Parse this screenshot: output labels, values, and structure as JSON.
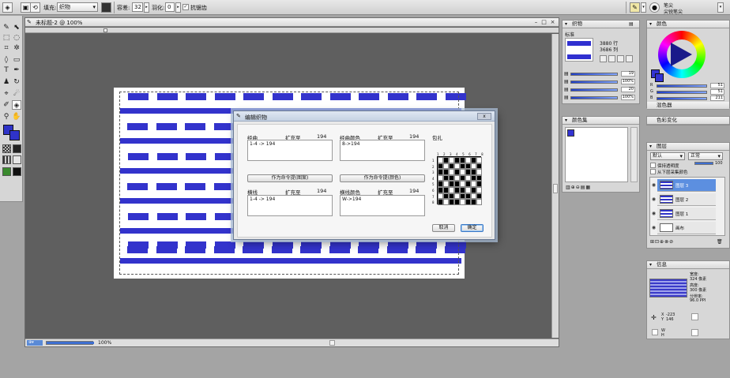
{
  "options_bar": {
    "fill_label": "填充:",
    "fill_value": "织物",
    "tolerance_label": "容差:",
    "tolerance_value": "32",
    "feather_label": "羽化:",
    "feather_value": "0",
    "antialias_label": "抗锯齿",
    "antialias_checked": true,
    "brush_line1": "笔尖",
    "brush_line2": "尖锐笔尖"
  },
  "document": {
    "title": "未标题-2 @ 100%",
    "zoom": "100%"
  },
  "canvas": {
    "bar_color": "#3333cc",
    "pattern": "woven"
  },
  "dialog": {
    "title": "编辑织物",
    "close": "x",
    "warp_label": "经曲",
    "warp_expand_label": "扩充至",
    "warp_expand_value": "194",
    "warp_text": "1-4 -> 194",
    "warp_color_label": "经曲颜色",
    "warp_color_expand_label": "扩充至",
    "warp_color_expand_value": "194",
    "warp_color_text": "8->194",
    "warp_cmd_button": "作为命令提(图案)",
    "weft_cmd_button": "作为命令提(颜色)",
    "weft_label": "横线",
    "weft_expand_label": "扩充至",
    "weft_expand_value": "194",
    "weft_text": "1-4 -> 194",
    "weft_color_label": "横线颜色",
    "weft_color_expand_label": "扩充至",
    "weft_color_expand_value": "194",
    "weft_color_text": "W->194",
    "peg_label": "包扎",
    "peg_col_numbers": "1 2 3 4 5 6 7 8",
    "peg_row_numbers": [
      "1",
      "2",
      "3",
      "4",
      "5",
      "6",
      "7",
      "8"
    ],
    "peg_grid": [
      [
        0,
        1,
        0,
        1,
        1,
        0,
        1,
        0
      ],
      [
        1,
        0,
        1,
        0,
        1,
        1,
        0,
        1
      ],
      [
        1,
        1,
        0,
        1,
        0,
        1,
        1,
        0
      ],
      [
        0,
        1,
        1,
        0,
        1,
        0,
        1,
        1
      ],
      [
        1,
        0,
        1,
        1,
        0,
        1,
        0,
        1
      ],
      [
        1,
        1,
        0,
        1,
        1,
        0,
        1,
        0
      ],
      [
        0,
        1,
        1,
        0,
        1,
        1,
        0,
        1
      ],
      [
        1,
        0,
        1,
        1,
        0,
        1,
        1,
        0
      ]
    ],
    "cancel": "取消",
    "ok": "确定"
  },
  "fabric_panel": {
    "tab": "织物",
    "preset": "标准",
    "rows": "3880 行",
    "cols": "3686 列",
    "values": [
      "19",
      "100%",
      "20",
      "100%"
    ]
  },
  "color_panel": {
    "tab": "颜色",
    "labels": [
      "R",
      "G",
      "B"
    ],
    "values": [
      "51",
      "51",
      "211"
    ],
    "sub_tab": "混色器"
  },
  "swatches_panel": {
    "tab": "颜色集",
    "variant_tab": "色彩变化"
  },
  "layers_panel": {
    "tab": "图层",
    "mode": "默认",
    "blend": "正常",
    "opacity": "100",
    "keep_transparency": "保持透明度",
    "from_below": "从下层采集颜色",
    "layers": [
      "图层 3",
      "图层 2",
      "图层 1",
      "画布"
    ]
  },
  "info_panel": {
    "tab": "信息",
    "width_label": "宽度:",
    "width_value": "324 像素",
    "height_label": "高度:",
    "height_value": "300 像素",
    "resolution_label": "分辨率:",
    "resolution_value": "96.0 PPI",
    "x_label": "X",
    "x_value": "-223",
    "y_label": "Y",
    "y_value": "146",
    "w_label": "W",
    "h_label": "H"
  }
}
